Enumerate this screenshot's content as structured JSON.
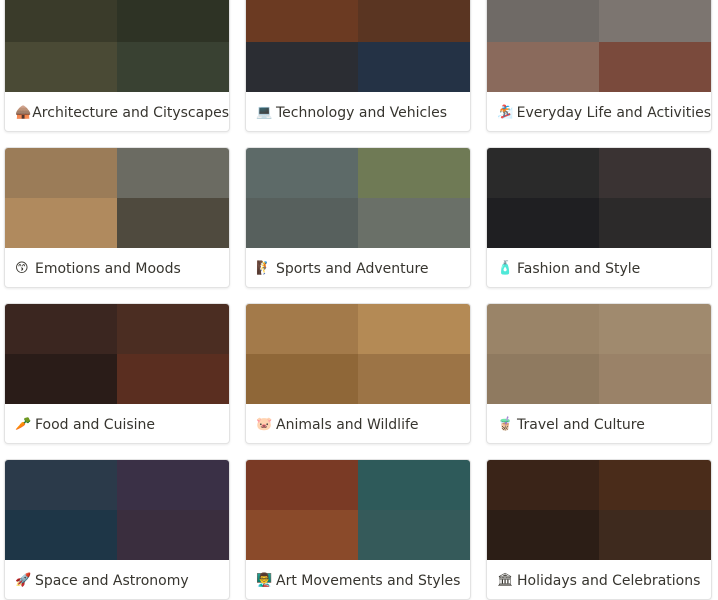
{
  "gallery": {
    "cards": [
      {
        "emoji": "🛖",
        "title": "Architecture and Cityscapes",
        "colors": [
          "#3a3b2a",
          "#2e3325",
          "#4a4a35",
          "#394132"
        ]
      },
      {
        "emoji": "💻",
        "title": "Technology and Vehicles",
        "colors": [
          "#6b3a22",
          "#5a3522",
          "#2b2d33",
          "#243245"
        ]
      },
      {
        "emoji": "🏂",
        "title": "Everyday Life and Activities",
        "colors": [
          "#6f6a66",
          "#7c7570",
          "#8a6a5c",
          "#7a4a3c"
        ]
      },
      {
        "emoji": "😙",
        "title": "Emotions and Moods",
        "colors": [
          "#9b7c58",
          "#6b6b62",
          "#b08a5e",
          "#4f4a3e"
        ]
      },
      {
        "emoji": "🧗",
        "title": "Sports and Adventure",
        "colors": [
          "#5d6a68",
          "#6f7a55",
          "#57605d",
          "#6a7068"
        ]
      },
      {
        "emoji": "🧴",
        "title": "Fashion and Style",
        "colors": [
          "#2a2a2a",
          "#3a3333",
          "#1f1f22",
          "#2c2a2a"
        ]
      },
      {
        "emoji": "🥕",
        "title": "Food and Cuisine",
        "colors": [
          "#3b2620",
          "#4b2d22",
          "#2a1c18",
          "#5a2e20"
        ]
      },
      {
        "emoji": "🐷",
        "title": "Animals and Wildlife",
        "colors": [
          "#a37a4a",
          "#b48a55",
          "#8f6738",
          "#9c7446"
        ]
      },
      {
        "emoji": "🧋",
        "title": "Travel and Culture",
        "colors": [
          "#9a8468",
          "#a08a6e",
          "#8f7a60",
          "#9a8268"
        ]
      },
      {
        "emoji": "🚀",
        "title": "Space and Astronomy",
        "colors": [
          "#2b3a4a",
          "#3a3046",
          "#1e3647",
          "#3a2e3e"
        ]
      },
      {
        "emoji": "👨‍🏫",
        "title": "Art Movements and Styles",
        "colors": [
          "#7a3a25",
          "#2e5a5a",
          "#8a4a2a",
          "#355a5a"
        ]
      },
      {
        "emoji": "🏛",
        "title": "Holidays and Celebrations",
        "colors": [
          "#3a2418",
          "#4a2c1a",
          "#2c1e16",
          "#3e2a1e"
        ]
      }
    ]
  }
}
